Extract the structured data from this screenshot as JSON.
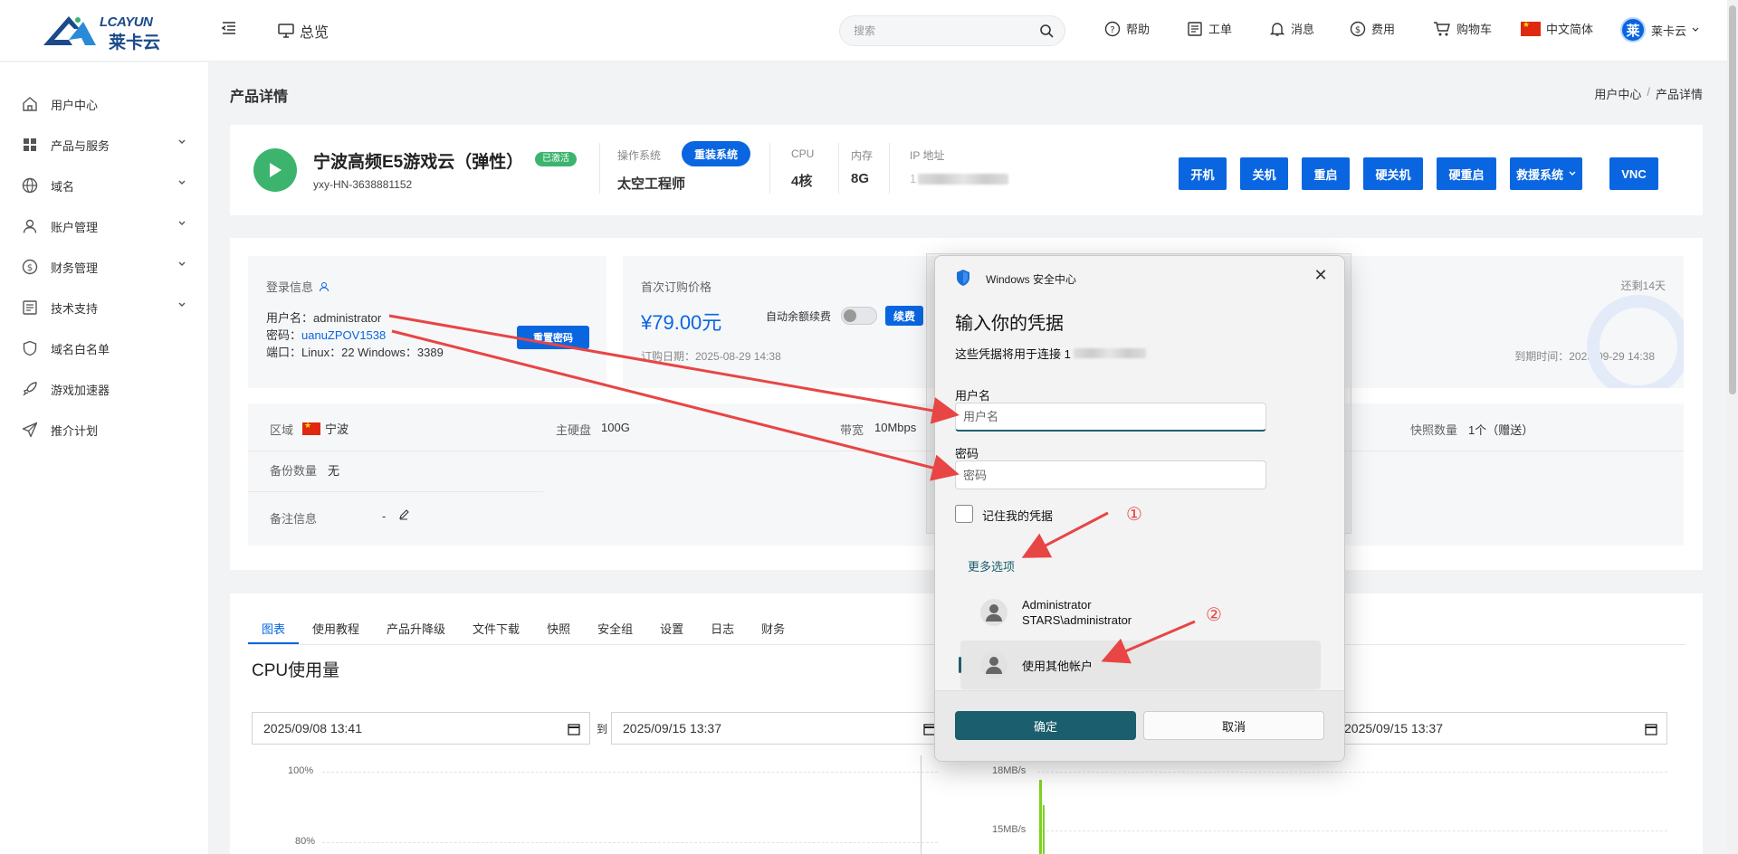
{
  "header": {
    "logo_text_1": "LCAYUN",
    "logo_text_2": "莱卡云",
    "overview": "总览",
    "search_placeholder": "搜索",
    "nav": [
      "帮助",
      "工单",
      "消息",
      "费用",
      "购物车"
    ],
    "language": "中文简体",
    "avatar_char": "莱",
    "user_name": "莱卡云"
  },
  "sidebar": {
    "items": [
      {
        "label": "用户中心",
        "icon": "home-icon",
        "expandable": false
      },
      {
        "label": "产品与服务",
        "icon": "grid-icon",
        "expandable": true
      },
      {
        "label": "域名",
        "icon": "globe-icon",
        "expandable": true
      },
      {
        "label": "账户管理",
        "icon": "user-icon",
        "expandable": true
      },
      {
        "label": "财务管理",
        "icon": "dollar-icon",
        "expandable": true
      },
      {
        "label": "技术支持",
        "icon": "support-icon",
        "expandable": true
      },
      {
        "label": "域名白名单",
        "icon": "shield-icon",
        "expandable": false
      },
      {
        "label": "游戏加速器",
        "icon": "rocket-icon",
        "expandable": false
      },
      {
        "label": "推介计划",
        "icon": "send-icon",
        "expandable": false
      }
    ]
  },
  "page": {
    "title": "产品详情",
    "breadcrumb": [
      "用户中心",
      "/",
      "产品详情"
    ]
  },
  "product": {
    "name": "宁波高频E5游戏云（弹性）",
    "status": "已激活",
    "id": "yxy-HN-3638881152",
    "os_label": "操作系统",
    "reinstall": "重装系统",
    "os_value": "太空工程师",
    "cpu_label": "CPU",
    "cpu_value": "4核",
    "mem_label": "内存",
    "mem_value": "8G",
    "ip_label": "IP 地址",
    "ip_value_prefix": "1",
    "actions": [
      "开机",
      "关机",
      "重启",
      "硬关机",
      "硬重启",
      "救援系统",
      "VNC"
    ],
    "accent_color": "#0a66e0",
    "status_color": "#3cb46e"
  },
  "login_info": {
    "title": "登录信息",
    "username_label": "用户名：",
    "username": "administrator",
    "password_label": "密码：",
    "password": "uanuZPOV1538",
    "port_label": "端口：",
    "port": "Linux：22 Windows：3389",
    "reset_btn": "重置密码"
  },
  "pricing": {
    "label": "首次订购价格",
    "price": "¥79.00元",
    "auto_renew": "自动余额续费",
    "renew_btn": "续费",
    "order_date": "订购日期：2025-08-29 14:38",
    "remaining": "还剩14天",
    "expire": "到期时间：2025-09-29 14:38"
  },
  "specs": {
    "region_label": "区域",
    "region": "宁波",
    "disk_label": "主硬盘",
    "disk": "100G",
    "bandwidth_label": "带宽",
    "bandwidth": "10Mbps",
    "snapshot_label": "快照数量",
    "snapshot": "1个（赠送）",
    "backup_label": "备份数量",
    "backup": "无",
    "note_label": "备注信息",
    "note": "-"
  },
  "tabs": [
    "图表",
    "使用教程",
    "产品升降级",
    "文件下载",
    "快照",
    "安全组",
    "设置",
    "日志",
    "财务"
  ],
  "chart": {
    "title": "CPU使用量",
    "date_from": "2025/09/08  13:41",
    "to": "到",
    "date_to": "2025/09/15  13:37",
    "date_to_right": "2025/09/15  13:37"
  },
  "chart_data": [
    {
      "type": "line",
      "title": "CPU使用量",
      "xlabel": "",
      "ylabel": "",
      "y_ticks": [
        "100%",
        "80%"
      ],
      "series": []
    },
    {
      "type": "line",
      "title": "",
      "xlabel": "",
      "ylabel": "",
      "y_ticks": [
        "18MB/s",
        "15MB/s"
      ],
      "series": []
    }
  ],
  "dialog": {
    "app": "Windows 安全中心",
    "heading": "输入你的凭据",
    "subtitle": "这些凭据将用于连接 1",
    "user_label": "用户名",
    "user_placeholder": "用户名",
    "pass_label": "密码",
    "pass_placeholder": "密码",
    "remember": "记住我的凭据",
    "more": "更多选项",
    "account_name": "Administrator",
    "account_domain": "STARS\\administrator",
    "other_account": "使用其他帐户",
    "ok": "确定",
    "cancel": "取消",
    "ok_color": "#1b5e6e"
  },
  "annotations": {
    "marker_1": "①",
    "marker_2": "②",
    "arrow_color": "#e84545"
  }
}
